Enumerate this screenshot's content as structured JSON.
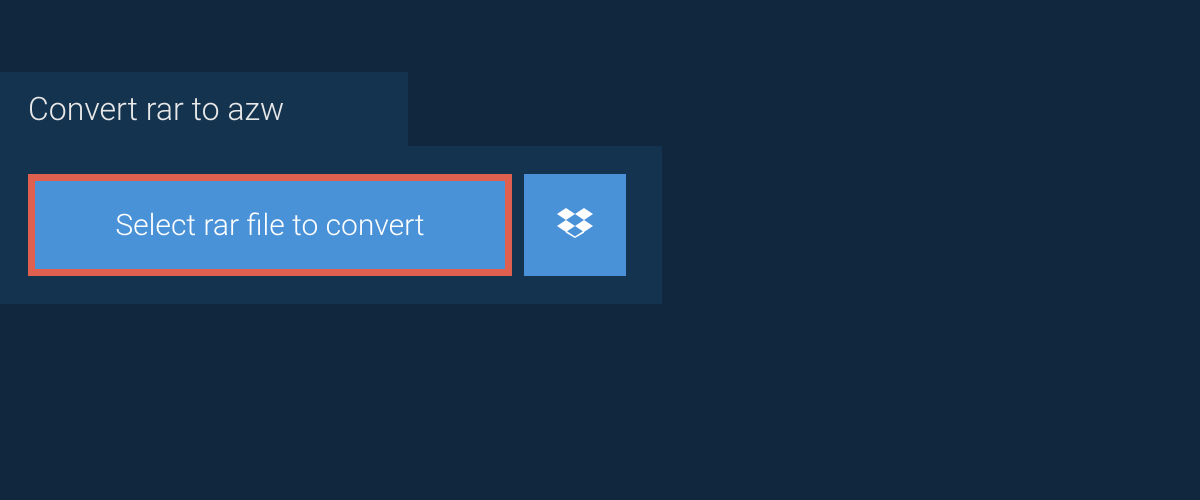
{
  "tab": {
    "title": "Convert rar to azw"
  },
  "actions": {
    "select_file_label": "Select rar file to convert"
  },
  "colors": {
    "page_bg": "#10273d",
    "panel_bg": "#14334f",
    "button_bg": "#4a92d8",
    "highlight_border": "#e06050"
  }
}
